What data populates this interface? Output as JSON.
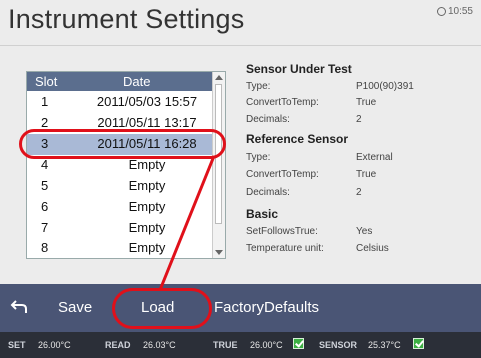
{
  "header": {
    "title": "Instrument Settings",
    "clock": "10:55"
  },
  "slot_list": {
    "col_slot": "Slot",
    "col_date": "Date",
    "rows": [
      {
        "slot": "1",
        "date": "2011/05/03 15:57"
      },
      {
        "slot": "2",
        "date": "2011/05/11 13:17"
      },
      {
        "slot": "3",
        "date": "2011/05/11 16:28"
      },
      {
        "slot": "4",
        "date": "Empty"
      },
      {
        "slot": "5",
        "date": "Empty"
      },
      {
        "slot": "6",
        "date": "Empty"
      },
      {
        "slot": "7",
        "date": "Empty"
      },
      {
        "slot": "8",
        "date": "Empty"
      }
    ],
    "selected_slot": "3"
  },
  "details": {
    "sensor_title": "Sensor Under Test",
    "sensor": {
      "type_label": "Type:",
      "type_value": "P100(90)391",
      "convert_label": "ConvertToTemp:",
      "convert_value": "True",
      "decimals_label": "Decimals:",
      "decimals_value": "2"
    },
    "reference_title": "Reference Sensor",
    "reference": {
      "type_label": "Type:",
      "type_value": "External",
      "convert_label": "ConvertToTemp:",
      "convert_value": "True",
      "decimals_label": "Decimals:",
      "decimals_value": "2"
    },
    "basic_title": "Basic",
    "basic": {
      "follows_label": "SetFollowsTrue:",
      "follows_value": "Yes",
      "unit_label": "Temperature unit:",
      "unit_value": "Celsius"
    }
  },
  "toolbar": {
    "back_icon": "back-arrow-icon",
    "save_label": "Save",
    "load_label": "Load",
    "factory_label": "FactoryDefaults"
  },
  "status": {
    "set_label": "SET",
    "set_value": "26.00°C",
    "read_label": "READ",
    "read_value": "26.03°C",
    "true_label": "TRUE",
    "true_value": "26.00°C",
    "sensor_label": "SENSOR",
    "sensor_value": "25.37°C"
  },
  "colors": {
    "toolbar_bg": "#4a5575",
    "status_bg": "#2b2f38",
    "list_header": "#5b6e8e",
    "selected_row": "#a9b9d6",
    "annotation": "#e0101a",
    "ok_check": "#3cb043"
  }
}
